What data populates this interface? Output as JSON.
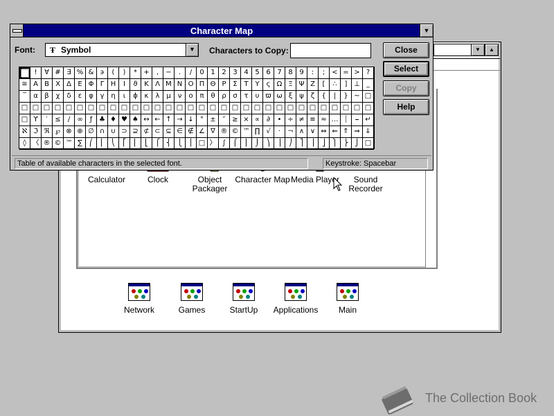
{
  "character_map": {
    "title": "Character Map",
    "font_label": "Font:",
    "font_value": "Symbol",
    "truetype_glyph": "Ŧ",
    "copy_label": "Characters to Copy:",
    "copy_value": "",
    "buttons": {
      "close": "Close",
      "select": "Select",
      "copy": "Copy",
      "help": "Help"
    },
    "status_text": "Table of available characters in the selected font.",
    "keystroke_text": "Keystroke: Spacebar",
    "grid_rows": [
      [
        " ",
        "!",
        "∀",
        "#",
        "∃",
        "%",
        "&",
        "϶",
        "(",
        ")",
        "*",
        "+",
        ",",
        "−",
        ".",
        "/",
        "0",
        "1",
        "2",
        "3",
        "4",
        "5",
        "6",
        "7",
        "8",
        "9",
        ":",
        ";",
        "<",
        "=",
        ">",
        "?"
      ],
      [
        "≅",
        "Α",
        "Β",
        "Χ",
        "Δ",
        "Ε",
        "Φ",
        "Γ",
        "Η",
        "Ι",
        "ϑ",
        "Κ",
        "Λ",
        "Μ",
        "Ν",
        "Ο",
        "Π",
        "Θ",
        "Ρ",
        "Σ",
        "Τ",
        "Υ",
        "ς",
        "Ω",
        "Ξ",
        "Ψ",
        "Ζ",
        "[",
        "∴",
        "]",
        "⊥",
        "_"
      ],
      [
        "‾",
        "α",
        "β",
        "χ",
        "δ",
        "ε",
        "φ",
        "γ",
        "η",
        "ι",
        "ϕ",
        "κ",
        "λ",
        "μ",
        "ν",
        "ο",
        "π",
        "θ",
        "ρ",
        "σ",
        "τ",
        "υ",
        "ϖ",
        "ω",
        "ξ",
        "ψ",
        "ζ",
        "{",
        "|",
        "}",
        "~",
        "□"
      ],
      [
        "□",
        "□",
        "□",
        "□",
        "□",
        "□",
        "□",
        "□",
        "□",
        "□",
        "□",
        "□",
        "□",
        "□",
        "□",
        "□",
        "□",
        "□",
        "□",
        "□",
        "□",
        "□",
        "□",
        "□",
        "□",
        "□",
        "□",
        "□",
        "□",
        "□",
        "□",
        "□"
      ],
      [
        "□",
        "ϒ",
        "′",
        "≤",
        "/",
        "∞",
        "ƒ",
        "♣",
        "♦",
        "♥",
        "♠",
        "↔",
        "←",
        "↑",
        "→",
        "↓",
        "°",
        "±",
        "″",
        "≥",
        "×",
        "∝",
        "∂",
        "•",
        "÷",
        "≠",
        "≡",
        "≈",
        "…",
        "⏐",
        "⎯",
        "↵"
      ],
      [
        "ℵ",
        "ℑ",
        "ℜ",
        "℘",
        "⊗",
        "⊕",
        "∅",
        "∩",
        "∪",
        "⊃",
        "⊇",
        "⊄",
        "⊂",
        "⊆",
        "∈",
        "∉",
        "∠",
        "∇",
        "®",
        "©",
        "™",
        "∏",
        "√",
        "·",
        "¬",
        "∧",
        "∨",
        "⇔",
        "⇐",
        "⇑",
        "⇒",
        "⇓"
      ],
      [
        "◊",
        "〈",
        "®",
        "©",
        "™",
        "∑",
        "⎛",
        "⎜",
        "⎝",
        "⎡",
        "⎢",
        "⎣",
        "⎧",
        "⎨",
        "⎩",
        "⎪",
        "□",
        "〉",
        "∫",
        "⌠",
        "⎮",
        "⌡",
        "⎞",
        "⎟",
        "⎠",
        "⎤",
        "⎥",
        "⎦",
        "⎫",
        "⎬",
        "⎭",
        "□"
      ]
    ]
  },
  "accessories": {
    "programs": [
      {
        "label": "Calculator"
      },
      {
        "label": "Clock"
      },
      {
        "label": "Object\nPackager"
      },
      {
        "label": "Character Map"
      },
      {
        "label": "Media Player"
      },
      {
        "label": "Sound\nRecorder"
      }
    ]
  },
  "groups": [
    {
      "label": "Network"
    },
    {
      "label": "Games"
    },
    {
      "label": "StartUp"
    },
    {
      "label": "Applications"
    },
    {
      "label": "Main"
    }
  ],
  "watermark": {
    "text": "The Collection Book",
    "icon": "book-icon"
  },
  "colors": {
    "titlebar": "#000080",
    "desktop": "#c0c0c0"
  }
}
